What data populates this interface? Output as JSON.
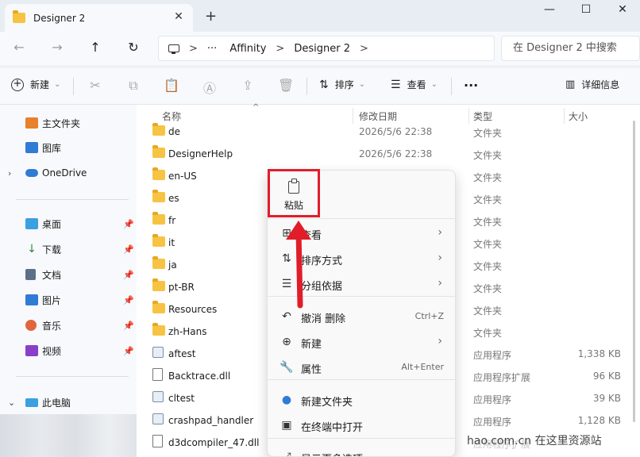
{
  "titlebar": {
    "tab_title": "Designer 2",
    "close_glyph": "✕",
    "new_tab_glyph": "+",
    "minimize_glyph": "—",
    "maximize_glyph": "☐",
    "window_close_glyph": "✕"
  },
  "navbar": {
    "back_glyph": "←",
    "forward_glyph": "→",
    "up_glyph": "↑",
    "refresh_glyph": "↻",
    "breadcrumb": {
      "sep1": ">",
      "ellipsis": "···",
      "crumb1": "Affinity",
      "sep2": ">",
      "crumb2": "Designer 2",
      "sep3": ">"
    },
    "search_placeholder": "在 Designer 2 中搜索"
  },
  "toolbar": {
    "new_label": "新建",
    "sort_label": "排序",
    "view_label": "查看",
    "more_glyph": "···",
    "details_label": "详细信息",
    "cut_icon": "✂",
    "copy_icon": "⧉",
    "paste_icon": "📋",
    "rename_icon": "Ⓐ",
    "share_icon": "⇪",
    "delete_icon": "🗑"
  },
  "sidebar": {
    "items": [
      {
        "label": "主文件夹",
        "color": "#e8802c"
      },
      {
        "label": "图库",
        "color": "#2f7bd6"
      },
      {
        "label": "OneDrive",
        "color": "#2f7bd6"
      },
      {
        "label": "桌面",
        "color": "#3aa0e0"
      },
      {
        "label": "下载",
        "color": "#2a8a3e"
      },
      {
        "label": "文档",
        "color": "#5b6f88"
      },
      {
        "label": "图片",
        "color": "#2f7bd6"
      },
      {
        "label": "音乐",
        "color": "#e0663c"
      },
      {
        "label": "视频",
        "color": "#8a3fc9"
      },
      {
        "label": "此电脑",
        "color": "#3aa0e0"
      }
    ],
    "pin_glyph": "📌",
    "expand_glyph": "›",
    "collapse_glyph": "⌄"
  },
  "columns": {
    "name": "名称",
    "date": "修改日期",
    "type": "类型",
    "size": "大小",
    "sort_glyph": "^"
  },
  "files": [
    {
      "name": "de",
      "date": "2026/5/6 22:38",
      "type": "文件夹",
      "size": "",
      "kind": "folder"
    },
    {
      "name": "DesignerHelp",
      "date": "2026/5/6 22:38",
      "type": "文件夹",
      "size": "",
      "kind": "folder"
    },
    {
      "name": "en-US",
      "date": "",
      "type": "文件夹",
      "size": "",
      "kind": "folder"
    },
    {
      "name": "es",
      "date": "",
      "type": "文件夹",
      "size": "",
      "kind": "folder"
    },
    {
      "name": "fr",
      "date": "",
      "type": "文件夹",
      "size": "",
      "kind": "folder"
    },
    {
      "name": "it",
      "date": "",
      "type": "文件夹",
      "size": "",
      "kind": "folder"
    },
    {
      "name": "ja",
      "date": "",
      "type": "文件夹",
      "size": "",
      "kind": "folder"
    },
    {
      "name": "pt-BR",
      "date": "",
      "type": "文件夹",
      "size": "",
      "kind": "folder"
    },
    {
      "name": "Resources",
      "date": "",
      "type": "文件夹",
      "size": "",
      "kind": "folder"
    },
    {
      "name": "zh-Hans",
      "date": "",
      "type": "文件夹",
      "size": "",
      "kind": "folder"
    },
    {
      "name": "aftest",
      "date": "",
      "type": "应用程序",
      "size": "1,338 KB",
      "kind": "app"
    },
    {
      "name": "Backtrace.dll",
      "date": "",
      "type": "应用程序扩展",
      "size": "96 KB",
      "kind": "dll"
    },
    {
      "name": "cltest",
      "date": "",
      "type": "应用程序",
      "size": "39 KB",
      "kind": "app"
    },
    {
      "name": "crashpad_handler",
      "date": "",
      "type": "应用程序",
      "size": "1,128 KB",
      "kind": "app"
    },
    {
      "name": "d3dcompiler_47.dll",
      "date": "",
      "type": "应用程序扩展",
      "size": "",
      "kind": "dll"
    }
  ],
  "context_menu": {
    "paste_label": "粘贴",
    "items": [
      {
        "label": "查看",
        "icon": "⊞",
        "shortcut": "",
        "submenu": "›"
      },
      {
        "label": "排序方式",
        "icon": "⇅",
        "shortcut": "",
        "submenu": "›"
      },
      {
        "label": "分组依据",
        "icon": "☰",
        "shortcut": "",
        "submenu": "›"
      },
      {
        "label": "撤消 删除",
        "icon": "↶",
        "shortcut": "Ctrl+Z",
        "submenu": ""
      },
      {
        "label": "新建",
        "icon": "⊕",
        "shortcut": "",
        "submenu": "›"
      },
      {
        "label": "属性",
        "icon": "🔧",
        "shortcut": "Alt+Enter",
        "submenu": ""
      },
      {
        "label": "新建文件夹",
        "icon": "●",
        "shortcut": "",
        "submenu": ""
      },
      {
        "label": "在终端中打开",
        "icon": "▣",
        "shortcut": "",
        "submenu": ""
      },
      {
        "label": "显示更多选项",
        "icon": "⤢",
        "shortcut": "",
        "submenu": ""
      }
    ]
  },
  "watermark": "hao.com.cn 在这里资源站",
  "colors": {
    "highlight": "#e11d2a",
    "folder": "#f6c442"
  }
}
